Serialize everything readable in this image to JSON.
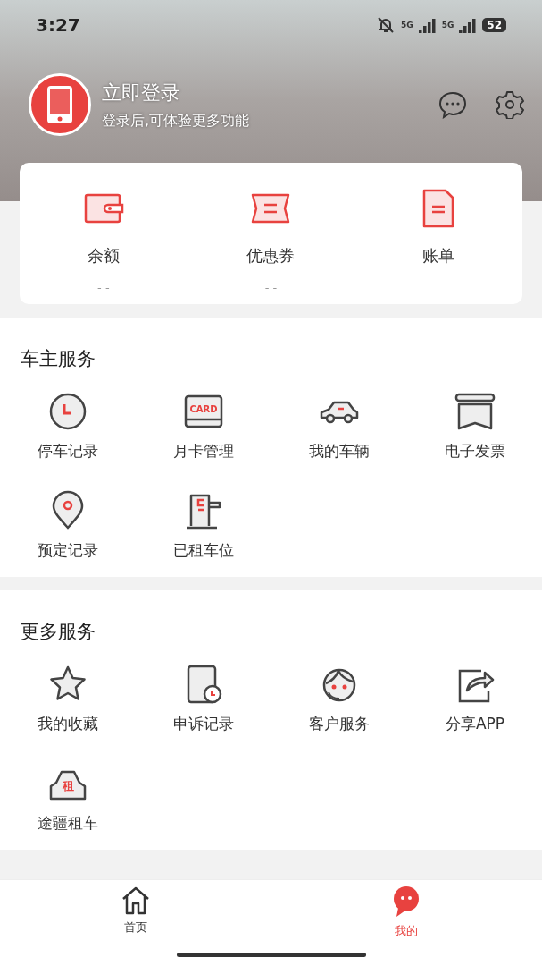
{
  "status_bar": {
    "time": "3:27",
    "network_labels": [
      "5G",
      "5G"
    ],
    "battery": "52"
  },
  "profile": {
    "title": "立即登录",
    "subtitle": "登录后,可体验更多功能"
  },
  "wallet": [
    {
      "label": "余额",
      "value": "- -"
    },
    {
      "label": "优惠券",
      "value": "- -"
    },
    {
      "label": "账单"
    }
  ],
  "sections": [
    {
      "title": "车主服务",
      "items": [
        {
          "label": "停车记录"
        },
        {
          "label": "月卡管理",
          "icon_text": "CARD"
        },
        {
          "label": "我的车辆"
        },
        {
          "label": "电子发票"
        },
        {
          "label": "预定记录"
        },
        {
          "label": "已租车位"
        }
      ]
    },
    {
      "title": "更多服务",
      "items": [
        {
          "label": "我的收藏"
        },
        {
          "label": "申诉记录"
        },
        {
          "label": "客户服务"
        },
        {
          "label": "分享APP"
        },
        {
          "label": "途疆租车",
          "icon_text": "租"
        }
      ]
    }
  ],
  "tab_bar": [
    {
      "label": "首页",
      "selected": false
    },
    {
      "label": "我的",
      "selected": true
    }
  ]
}
